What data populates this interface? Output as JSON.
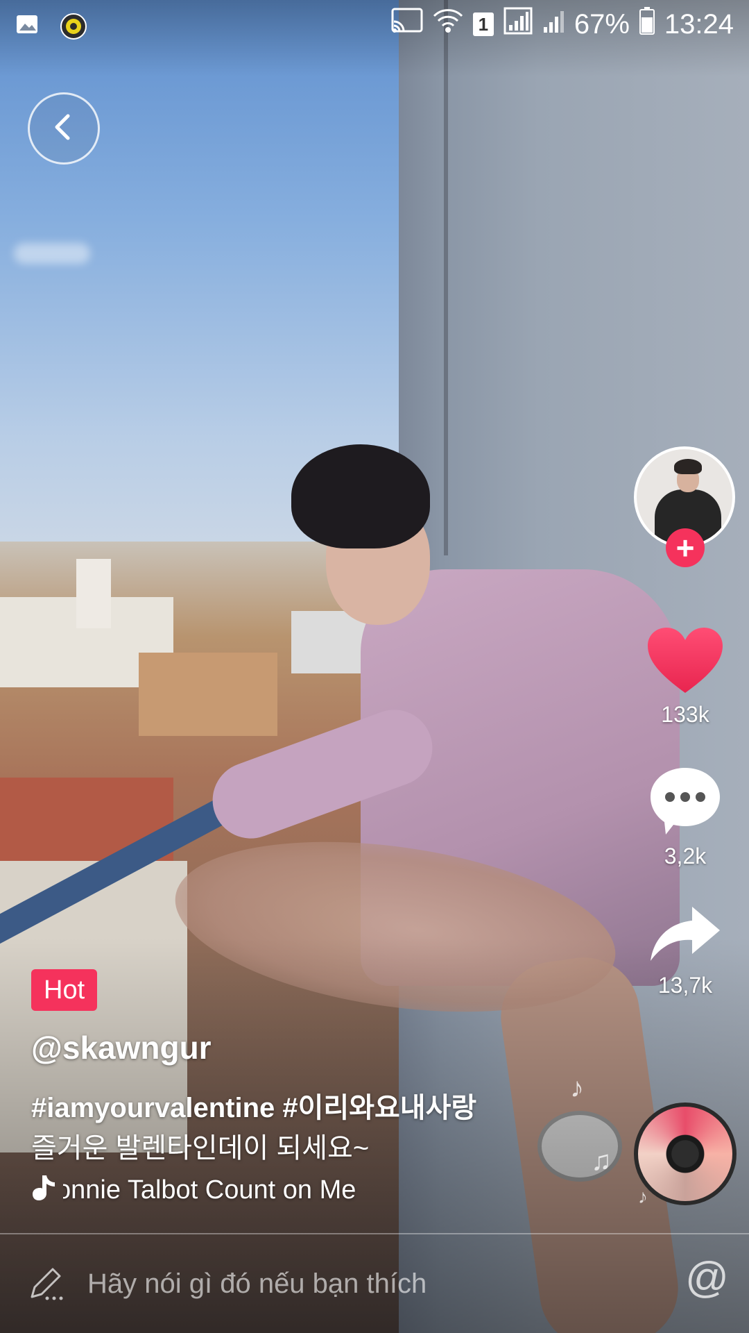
{
  "status_bar": {
    "battery": "67%",
    "time": "13:24",
    "sim_slot": "1",
    "icons": [
      "gallery-icon",
      "app-notification-icon",
      "cast-icon",
      "wifi-icon",
      "signal-icon",
      "signal-icon-2",
      "battery-icon"
    ]
  },
  "video": {
    "badge": "Hot",
    "username": "@skawngur",
    "hashtags": "#iamyourvalentine #이리와요내사랑",
    "caption": "즐거운 발렌타인데이 되세요~",
    "music_ticker": "onnie Talbot    Count on Me"
  },
  "actions": {
    "likes": "133k",
    "comments": "3,2k",
    "shares": "13,7k"
  },
  "comment_bar": {
    "placeholder": "Hãy nói gì đó nếu bạn thích",
    "at_symbol": "@"
  },
  "colors": {
    "accent": "#f5325c",
    "like_heart": "#f5325c",
    "text": "#ffffff"
  }
}
